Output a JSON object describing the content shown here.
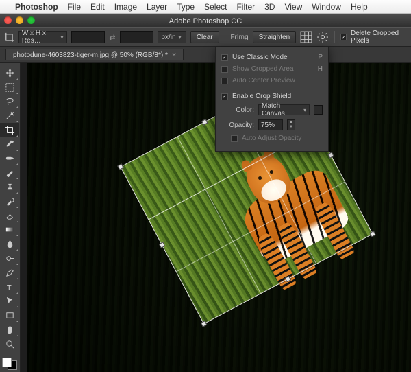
{
  "mac_menu": {
    "apple": "",
    "app": "Photoshop",
    "items": [
      "File",
      "Edit",
      "Image",
      "Layer",
      "Type",
      "Select",
      "Filter",
      "3D",
      "View",
      "Window",
      "Help"
    ]
  },
  "window": {
    "title": "Adobe Photoshop CC"
  },
  "options_bar": {
    "preset": "W x H x Res…",
    "unit": "px/in",
    "clear": "Clear",
    "front_img": "FrImg",
    "straighten": "Straighten",
    "delete_cropped": "Delete Cropped Pixels",
    "delete_cropped_checked": true
  },
  "gear_menu": {
    "use_classic_mode": {
      "label": "Use Classic Mode",
      "checked": true,
      "hint": "P"
    },
    "show_cropped_area": {
      "label": "Show Cropped Area",
      "checked": false,
      "hint": "H",
      "enabled": false
    },
    "auto_center_preview": {
      "label": "Auto Center Preview",
      "checked": false,
      "enabled": false
    },
    "enable_crop_shield": {
      "label": "Enable Crop Shield",
      "checked": true
    },
    "color": {
      "label": "Color:",
      "value": "Match Canvas"
    },
    "opacity": {
      "label": "Opacity:",
      "value": "75%"
    },
    "auto_adjust_opacity": {
      "label": "Auto Adjust Opacity",
      "checked": false,
      "enabled": false
    }
  },
  "doc_tab": {
    "name": "photodune-4603823-tiger-m.jpg @ 50% (RGB/8*) *"
  },
  "tools": [
    {
      "id": "move",
      "kind": "move"
    },
    {
      "id": "marquee",
      "kind": "marquee"
    },
    {
      "id": "lasso",
      "kind": "lasso"
    },
    {
      "id": "magic-wand",
      "kind": "wand"
    },
    {
      "id": "crop",
      "kind": "crop",
      "active": true
    },
    {
      "id": "eyedropper",
      "kind": "eyedropper"
    },
    {
      "id": "healing",
      "kind": "heal"
    },
    {
      "id": "brush",
      "kind": "brush"
    },
    {
      "id": "clone",
      "kind": "clone"
    },
    {
      "id": "history-brush",
      "kind": "history"
    },
    {
      "id": "eraser",
      "kind": "eraser"
    },
    {
      "id": "gradient",
      "kind": "gradient"
    },
    {
      "id": "blur",
      "kind": "blur"
    },
    {
      "id": "dodge",
      "kind": "dodge"
    },
    {
      "id": "pen",
      "kind": "pen"
    },
    {
      "id": "type",
      "kind": "type"
    },
    {
      "id": "path",
      "kind": "path"
    },
    {
      "id": "rectangle",
      "kind": "shape"
    },
    {
      "id": "hand",
      "kind": "hand"
    },
    {
      "id": "zoom",
      "kind": "zoom"
    }
  ],
  "canvas": {
    "subject": "tiger in jungle foliage",
    "crop_rotation_deg": -28
  }
}
